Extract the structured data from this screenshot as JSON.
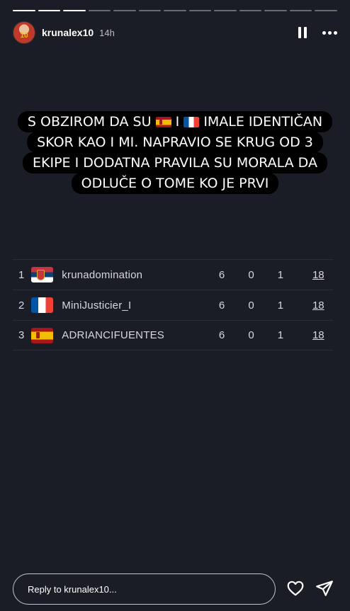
{
  "header": {
    "username": "krunalex10",
    "time": "14h",
    "avatar_number": "10"
  },
  "caption": {
    "line1_pre": "S OBZIROM DA SU",
    "line1_mid": "I",
    "line1_post": "IMALE IDENTIČAN",
    "line2": "SKOR KAO I MI. NAPRAVIO SE KRUG OD 3",
    "line3": "EKIPE I DODATNA PRAVILA SU MORALA DA",
    "line4": "ODLUČE O TOME KO JE PRVI",
    "flags": [
      "spain-flag",
      "france-flag"
    ]
  },
  "standings": [
    {
      "rank": "1",
      "flag": "serbia-flag",
      "team": "krunadomination",
      "w": "6",
      "d": "0",
      "l": "1",
      "pts": "18"
    },
    {
      "rank": "2",
      "flag": "france-flag",
      "team": "MiniJusticier_I",
      "w": "6",
      "d": "0",
      "l": "1",
      "pts": "18"
    },
    {
      "rank": "3",
      "flag": "spain-flag",
      "team": "ADRIANCIFUENTES",
      "w": "6",
      "d": "0",
      "l": "1",
      "pts": "18"
    }
  ],
  "reply": {
    "placeholder": "Reply to krunalex10..."
  },
  "progress": {
    "total": 13,
    "completed": 3
  },
  "colors": {
    "background": "#1b1d26",
    "caption_bg": "#000000"
  }
}
